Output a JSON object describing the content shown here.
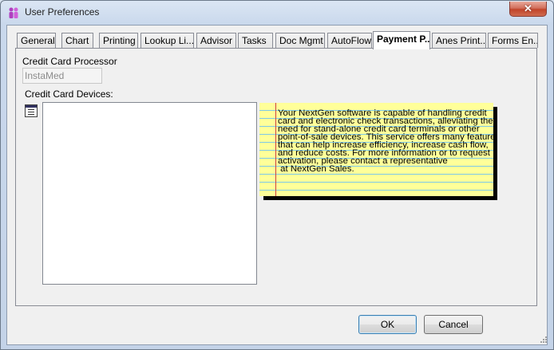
{
  "window": {
    "title": "User Preferences",
    "close_label": "✕"
  },
  "tabs": [
    {
      "label": "General"
    },
    {
      "label": "Chart"
    },
    {
      "label": "Printing"
    },
    {
      "label": "Lookup Li..."
    },
    {
      "label": "Advisor"
    },
    {
      "label": "Tasks"
    },
    {
      "label": "Doc Mgmt"
    },
    {
      "label": "AutoFlow"
    },
    {
      "label": "Payment P..."
    },
    {
      "label": "Anes Print..."
    },
    {
      "label": "Forms En..."
    }
  ],
  "active_tab": "Payment P...",
  "payment": {
    "processor_label": "Credit Card Processor",
    "processor_value": "InstaMed",
    "devices_label": "Credit Card Devices:",
    "note_text": "Your NextGen software is capable of handling credit\ncard and electronic check transactions, alleviating the\nneed for stand-alone credit card terminals or other\npoint-of-sale devices. This service offers many features\nthat can help increase efficiency, increase cash flow,\nand reduce costs. For more information or to request\nactivation, please contact a representative\n at NextGen Sales."
  },
  "buttons": {
    "ok": "OK",
    "cancel": "Cancel"
  }
}
